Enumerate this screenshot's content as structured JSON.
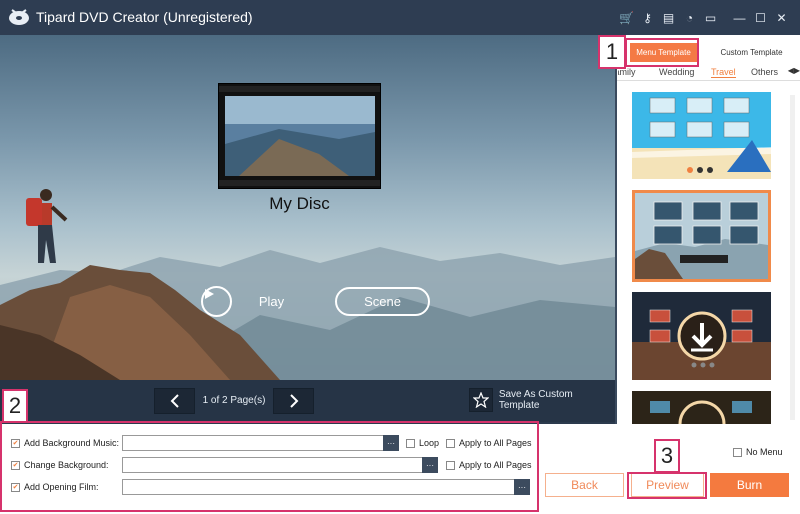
{
  "app": {
    "title": "Tipard DVD Creator (Unregistered)"
  },
  "titlebar_icons": [
    "cart-icon",
    "key-icon",
    "register-icon",
    "chat-icon",
    "feedback-icon",
    "minimize-icon",
    "maximize-icon",
    "close-icon"
  ],
  "preview": {
    "disc_title": "My Disc",
    "play_label": "Play",
    "scene_label": "Scene"
  },
  "pagination": {
    "info": "1 of 2 Page(s)",
    "save_template_label": "Save As Custom Template"
  },
  "template_panel": {
    "tabs": [
      "Menu Template",
      "Custom Template"
    ],
    "categories": [
      "Family",
      "Wedding",
      "Travel",
      "Others"
    ],
    "active_category": "Travel",
    "selected_template_index": 1
  },
  "options": {
    "background_music": {
      "label": "Add Background Music:",
      "value": "",
      "loop_label": "Loop",
      "apply_label": "Apply to All Pages"
    },
    "background": {
      "label": "Change Background:",
      "value": "",
      "apply_label": "Apply to All Pages"
    },
    "opening_film": {
      "label": "Add Opening Film:",
      "value": ""
    },
    "browse_label": "···"
  },
  "actions": {
    "no_menu_label": "No Menu",
    "back_label": "Back",
    "preview_label": "Preview",
    "burn_label": "Burn"
  },
  "markers": [
    "1",
    "2",
    "3"
  ],
  "colors": {
    "accent": "#f47a45",
    "marker": "#d6336c",
    "titlebar": "#2e3d52"
  }
}
